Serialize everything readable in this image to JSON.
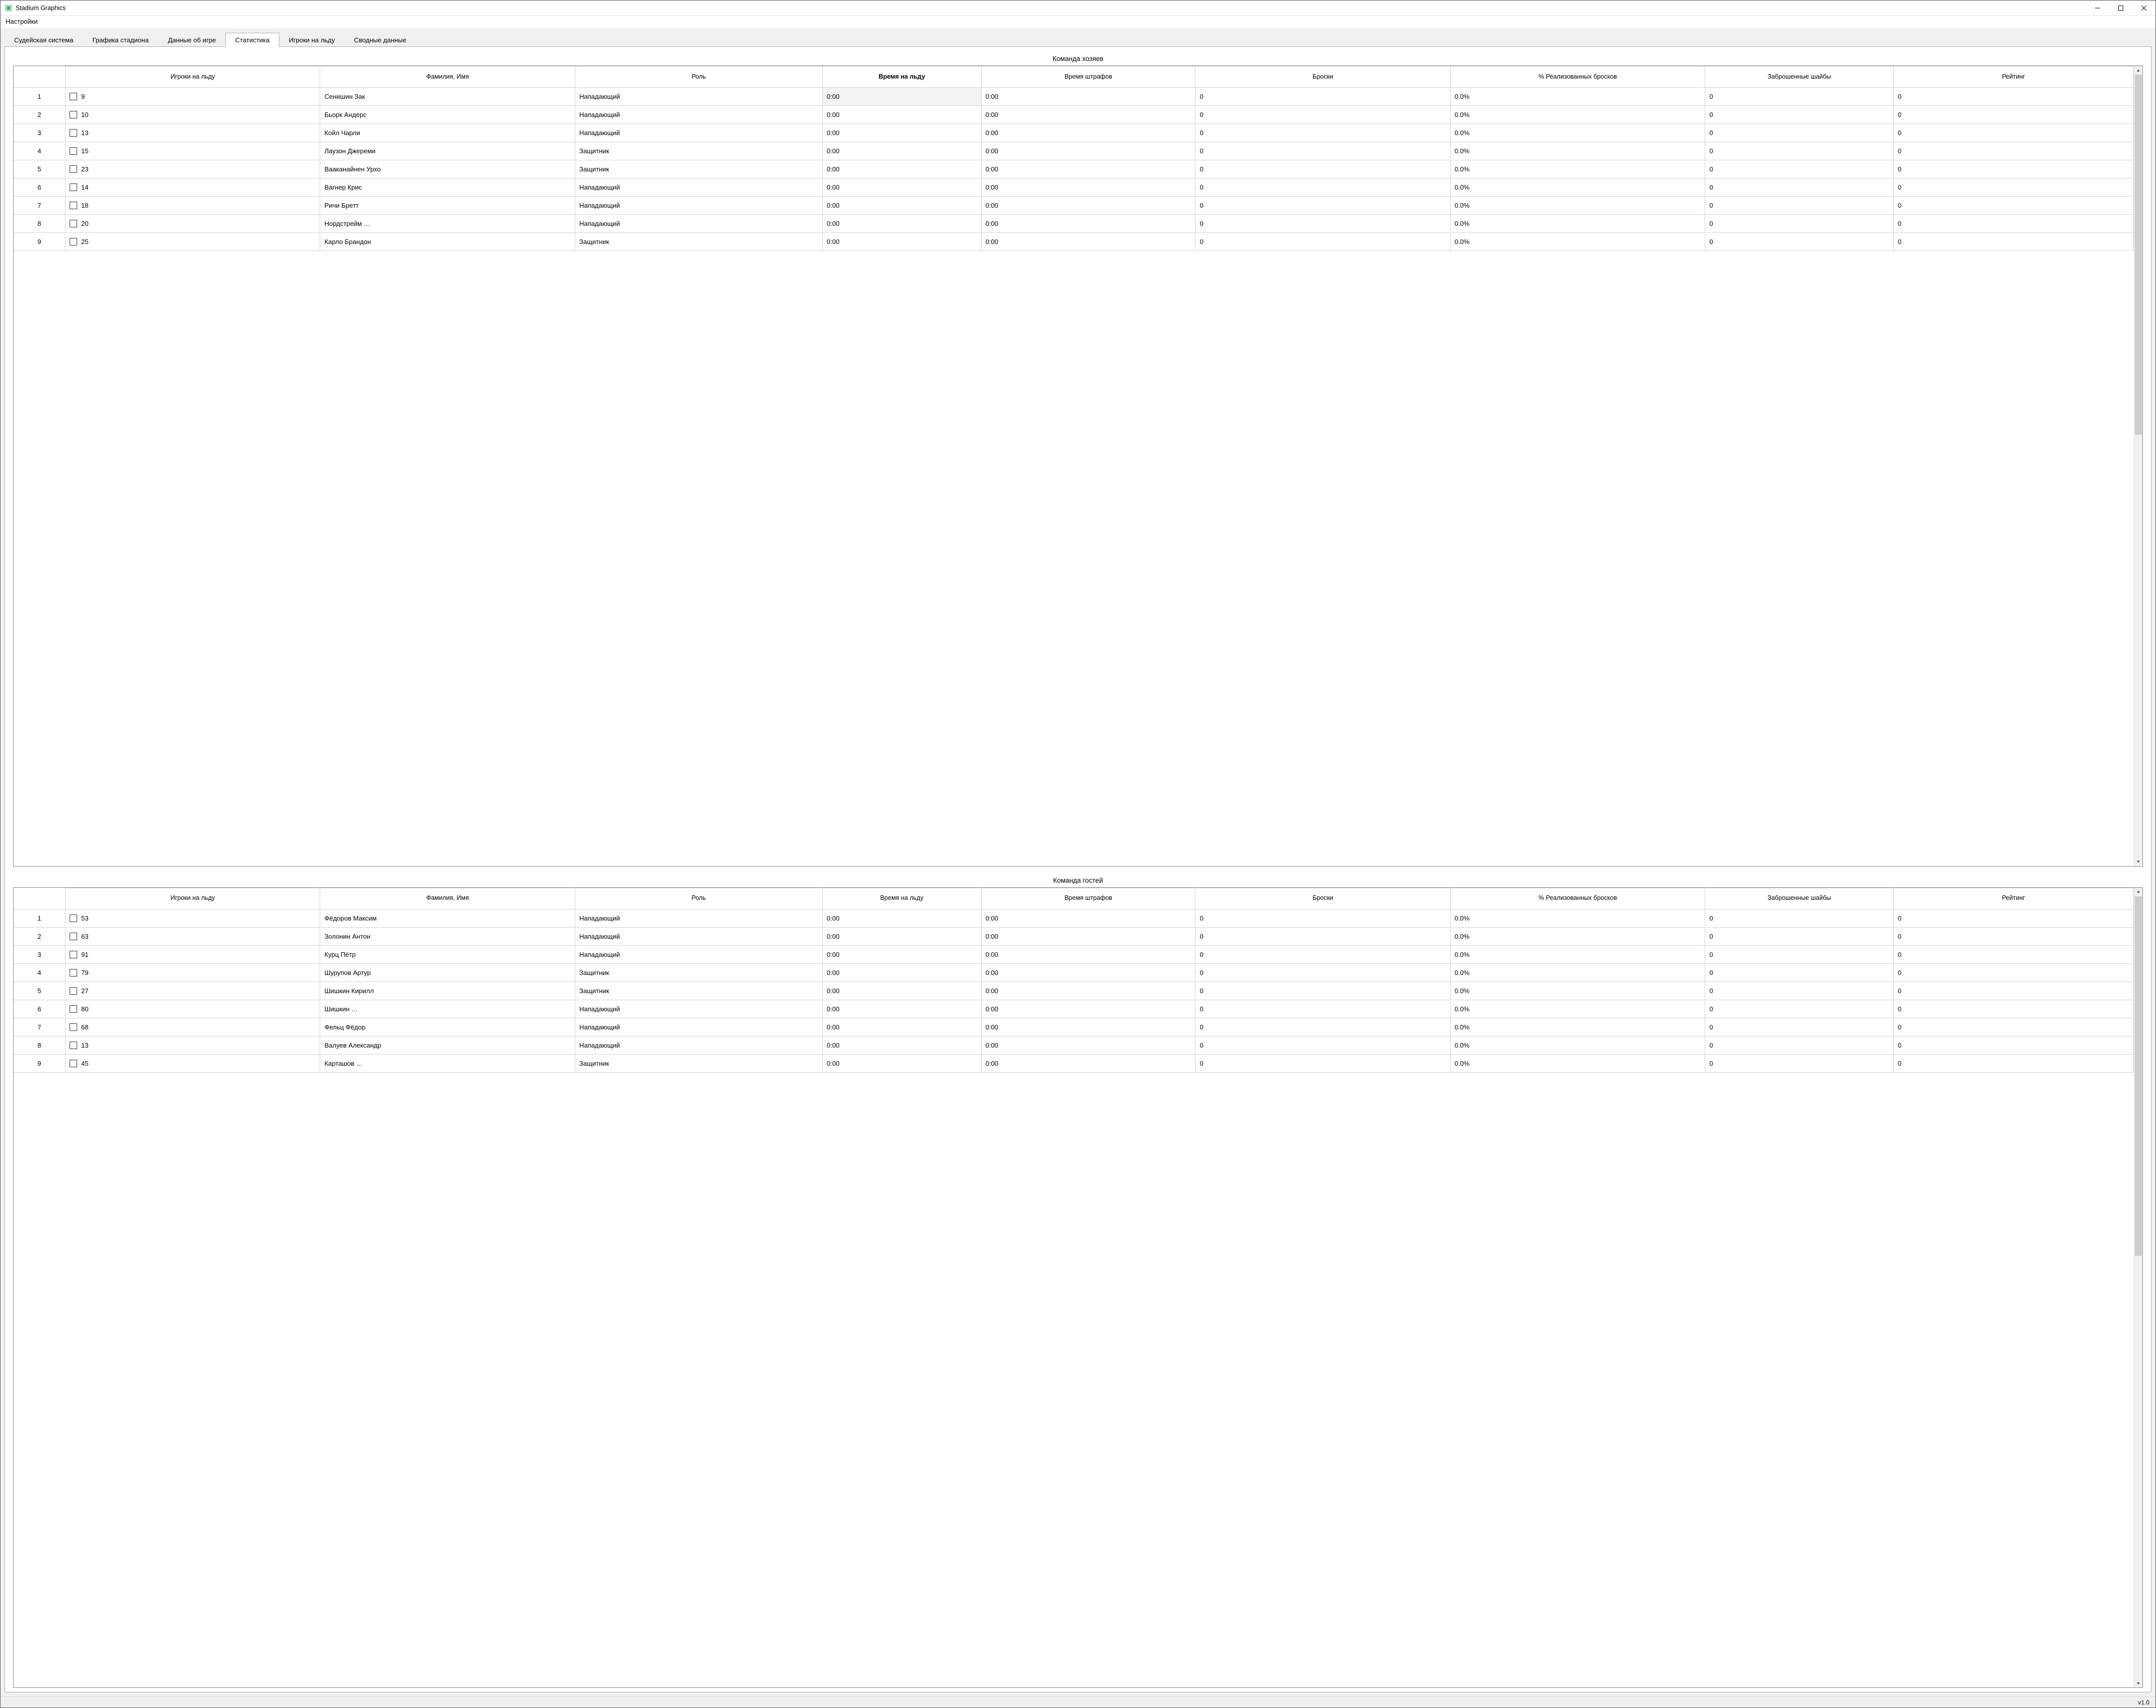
{
  "window": {
    "title": "Stadium Graphics",
    "version": "v1.0"
  },
  "menubar": {
    "settings": "Настройки"
  },
  "tabs": [
    {
      "label": "Судейская система",
      "active": false
    },
    {
      "label": "Графика стадиона",
      "active": false
    },
    {
      "label": "Данные об игре",
      "active": false
    },
    {
      "label": "Статистика",
      "active": true
    },
    {
      "label": "Игроки на льду",
      "active": false
    },
    {
      "label": "Сводные данные",
      "active": false
    }
  ],
  "columns": {
    "on_ice": "Игроки на льду",
    "name": "Фамилия, Имя",
    "role": "Роль",
    "time_on_ice": "Время на льду",
    "penalty_time": "Время штрафов",
    "shots": "Броски",
    "shot_pct": "% Реализованных бросков",
    "goals": "Заброшенные шайбы",
    "rating": "Рейтинг"
  },
  "teams": {
    "home": {
      "title": "Команда хозяев",
      "sorted_column": "time_on_ice",
      "selected_row": 0,
      "rows": [
        {
          "num": "9",
          "check": false,
          "name": "Сенишин Зак",
          "role": "Нападающий",
          "toi": "0:00",
          "pim": "0:00",
          "shots": "0",
          "pct": "0.0%",
          "goals": "0",
          "rating": "0"
        },
        {
          "num": "10",
          "check": false,
          "name": "Бьорк Андерс",
          "role": "Нападающий",
          "toi": "0:00",
          "pim": "0:00",
          "shots": "0",
          "pct": "0.0%",
          "goals": "0",
          "rating": "0"
        },
        {
          "num": "13",
          "check": false,
          "name": "Койл Чарли",
          "role": "Нападающий",
          "toi": "0:00",
          "pim": "0:00",
          "shots": "0",
          "pct": "0.0%",
          "goals": "0",
          "rating": "0"
        },
        {
          "num": "15",
          "check": false,
          "name": "Лаузон Джереми",
          "role": "Защитник",
          "toi": "0:00",
          "pim": "0:00",
          "shots": "0",
          "pct": "0.0%",
          "goals": "0",
          "rating": "0"
        },
        {
          "num": "23",
          "check": false,
          "name": "Вааканайнен Урхо",
          "role": "Защитник",
          "toi": "0:00",
          "pim": "0:00",
          "shots": "0",
          "pct": "0.0%",
          "goals": "0",
          "rating": "0"
        },
        {
          "num": "14",
          "check": false,
          "name": "Вагнер Крис",
          "role": "Нападающий",
          "toi": "0:00",
          "pim": "0:00",
          "shots": "0",
          "pct": "0.0%",
          "goals": "0",
          "rating": "0"
        },
        {
          "num": "18",
          "check": false,
          "name": "Ричи Бретт",
          "role": "Нападающий",
          "toi": "0:00",
          "pim": "0:00",
          "shots": "0",
          "pct": "0.0%",
          "goals": "0",
          "rating": "0"
        },
        {
          "num": "20",
          "check": false,
          "name": "Нордстрейм …",
          "role": "Нападающий",
          "toi": "0:00",
          "pim": "0:00",
          "shots": "0",
          "pct": "0.0%",
          "goals": "0",
          "rating": "0"
        },
        {
          "num": "25",
          "check": false,
          "name": "Карло Брандон",
          "role": "Защитник",
          "toi": "0:00",
          "pim": "0:00",
          "shots": "0",
          "pct": "0.0%",
          "goals": "0",
          "rating": "0"
        }
      ]
    },
    "away": {
      "title": "Команда гостей",
      "sorted_column": null,
      "selected_row": null,
      "rows": [
        {
          "num": "53",
          "check": false,
          "name": "Фёдоров Максим",
          "role": "Нападающий",
          "toi": "0:00",
          "pim": "0:00",
          "shots": "0",
          "pct": "0.0%",
          "goals": "0",
          "rating": "0"
        },
        {
          "num": "63",
          "check": false,
          "name": "Золонин Антон",
          "role": "Нападающий",
          "toi": "0:00",
          "pim": "0:00",
          "shots": "0",
          "pct": "0.0%",
          "goals": "0",
          "rating": "0"
        },
        {
          "num": "91",
          "check": false,
          "name": "Курц Пётр",
          "role": "Нападающий",
          "toi": "0:00",
          "pim": "0:00",
          "shots": "0",
          "pct": "0.0%",
          "goals": "0",
          "rating": "0"
        },
        {
          "num": "79",
          "check": false,
          "name": "Шурупов Артур",
          "role": "Защитник",
          "toi": "0:00",
          "pim": "0:00",
          "shots": "0",
          "pct": "0.0%",
          "goals": "0",
          "rating": "0"
        },
        {
          "num": "27",
          "check": false,
          "name": "Шишкин Кирилл",
          "role": "Защитник",
          "toi": "0:00",
          "pim": "0:00",
          "shots": "0",
          "pct": "0.0%",
          "goals": "0",
          "rating": "0"
        },
        {
          "num": "80",
          "check": false,
          "name": "Шишкин …",
          "role": "Нападающий",
          "toi": "0:00",
          "pim": "0:00",
          "shots": "0",
          "pct": "0.0%",
          "goals": "0",
          "rating": "0"
        },
        {
          "num": "68",
          "check": false,
          "name": "Фельц Фёдор",
          "role": "Нападающий",
          "toi": "0:00",
          "pim": "0:00",
          "shots": "0",
          "pct": "0.0%",
          "goals": "0",
          "rating": "0"
        },
        {
          "num": "13",
          "check": false,
          "name": "Валуев Александр",
          "role": "Нападающий",
          "toi": "0:00",
          "pim": "0:00",
          "shots": "0",
          "pct": "0.0%",
          "goals": "0",
          "rating": "0"
        },
        {
          "num": "45",
          "check": false,
          "name": "Карташов …",
          "role": "Защитник",
          "toi": "0:00",
          "pim": "0:00",
          "shots": "0",
          "pct": "0.0%",
          "goals": "0",
          "rating": "0"
        }
      ]
    }
  }
}
